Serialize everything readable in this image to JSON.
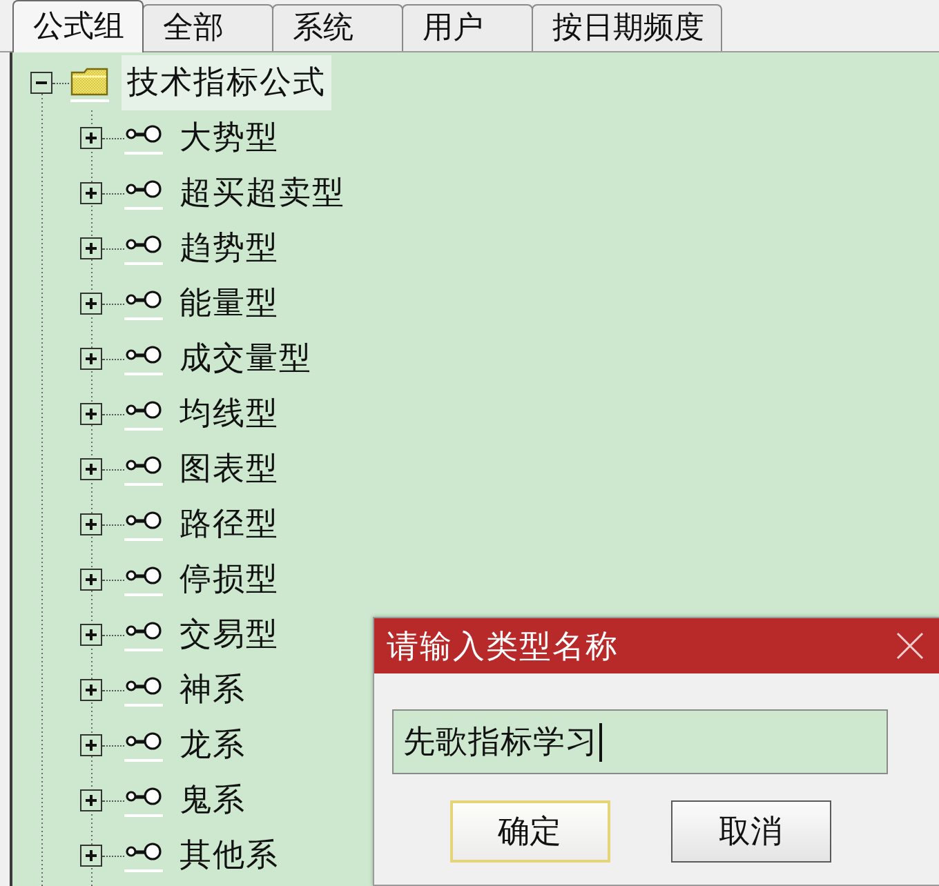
{
  "tabs": [
    {
      "label": "公式组",
      "selected": true
    },
    {
      "label": "全部",
      "selected": false
    },
    {
      "label": "系统",
      "selected": false
    },
    {
      "label": "用户",
      "selected": false
    },
    {
      "label": "按日期频度",
      "selected": false
    }
  ],
  "tree": {
    "items": [
      {
        "kind": "folder",
        "label": "技术指标公式",
        "expanded": true,
        "selected": true,
        "children": [
          {
            "kind": "group",
            "label": "大势型",
            "expanded": false,
            "selected": false
          },
          {
            "kind": "group",
            "label": "超买超卖型",
            "expanded": false,
            "selected": false
          },
          {
            "kind": "group",
            "label": "趋势型",
            "expanded": false,
            "selected": false
          },
          {
            "kind": "group",
            "label": "能量型",
            "expanded": false,
            "selected": false
          },
          {
            "kind": "group",
            "label": "成交量型",
            "expanded": false,
            "selected": false
          },
          {
            "kind": "group",
            "label": "均线型",
            "expanded": false,
            "selected": false
          },
          {
            "kind": "group",
            "label": "图表型",
            "expanded": false,
            "selected": false
          },
          {
            "kind": "group",
            "label": "路径型",
            "expanded": false,
            "selected": false
          },
          {
            "kind": "group",
            "label": "停损型",
            "expanded": false,
            "selected": false
          },
          {
            "kind": "group",
            "label": "交易型",
            "expanded": false,
            "selected": false
          },
          {
            "kind": "group",
            "label": "神系",
            "expanded": false,
            "selected": false
          },
          {
            "kind": "group",
            "label": "龙系",
            "expanded": false,
            "selected": false
          },
          {
            "kind": "group",
            "label": "鬼系",
            "expanded": false,
            "selected": false
          },
          {
            "kind": "group",
            "label": "其他系",
            "expanded": false,
            "selected": false
          }
        ]
      }
    ]
  },
  "dialog": {
    "title": "请输入类型名称",
    "input": {
      "value": "先歌指标学习"
    },
    "buttons": [
      {
        "label": "确定",
        "default": true
      },
      {
        "label": "取消",
        "default": false
      }
    ]
  }
}
